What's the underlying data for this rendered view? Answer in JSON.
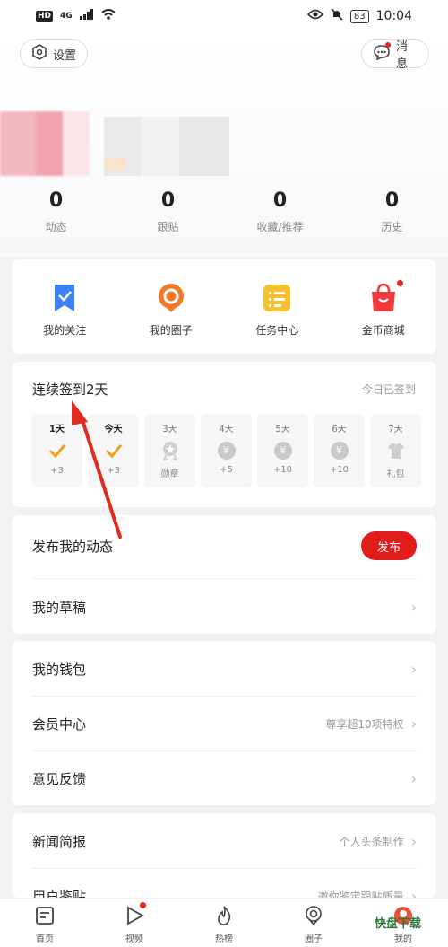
{
  "status_bar": {
    "network_badge": "HD",
    "signal": "4G",
    "battery": "83",
    "time": "10:04"
  },
  "header": {
    "settings_label": "设置",
    "messages_label": "消息"
  },
  "stats": [
    {
      "value": "0",
      "label": "动态"
    },
    {
      "value": "0",
      "label": "跟贴"
    },
    {
      "value": "0",
      "label": "收藏/推荐"
    },
    {
      "value": "0",
      "label": "历史"
    }
  ],
  "quick_links": [
    {
      "label": "我的关注",
      "icon": "bookmark-icon",
      "color": "#3b82f6"
    },
    {
      "label": "我的圈子",
      "icon": "circle-icon",
      "color": "#f07a2a"
    },
    {
      "label": "任务中心",
      "icon": "task-list-icon",
      "color": "#f7c12e"
    },
    {
      "label": "金币商城",
      "icon": "shopping-bag-icon",
      "color": "#ee3b3b"
    }
  ],
  "checkin": {
    "title": "连续签到2天",
    "status": "今日已签到",
    "days": [
      {
        "label": "1天",
        "reward": "+3",
        "done": true
      },
      {
        "label": "今天",
        "reward": "+3",
        "done": true
      },
      {
        "label": "3天",
        "reward": "勋章",
        "done": false
      },
      {
        "label": "4天",
        "reward": "+5",
        "done": false
      },
      {
        "label": "5天",
        "reward": "+10",
        "done": false
      },
      {
        "label": "6天",
        "reward": "+10",
        "done": false
      },
      {
        "label": "7天",
        "reward": "礼包",
        "done": false
      }
    ]
  },
  "posts": {
    "publish_row": "发布我的动态",
    "publish_button": "发布",
    "drafts_row": "我的草稿"
  },
  "account": {
    "wallet": "我的钱包",
    "vip": "会员中心",
    "vip_hint": "尊享超10项特权",
    "feedback": "意见反馈"
  },
  "extras": {
    "news_brief": "新闻简报",
    "news_hint": "个人头条制作",
    "reviewer": "用户鉴贴",
    "reviewer_hint": "邀你鉴定跟贴质量"
  },
  "bottom_nav": [
    {
      "label": "首页",
      "icon": "home-icon"
    },
    {
      "label": "视频",
      "icon": "video-play-icon"
    },
    {
      "label": "热榜",
      "icon": "flame-icon"
    },
    {
      "label": "圈子",
      "icon": "location-circle-icon"
    },
    {
      "label": "我的",
      "icon": "profile-icon"
    }
  ],
  "watermark": "快盘下载",
  "colors": {
    "accent": "#e21b1b",
    "check": "#f0a020"
  }
}
